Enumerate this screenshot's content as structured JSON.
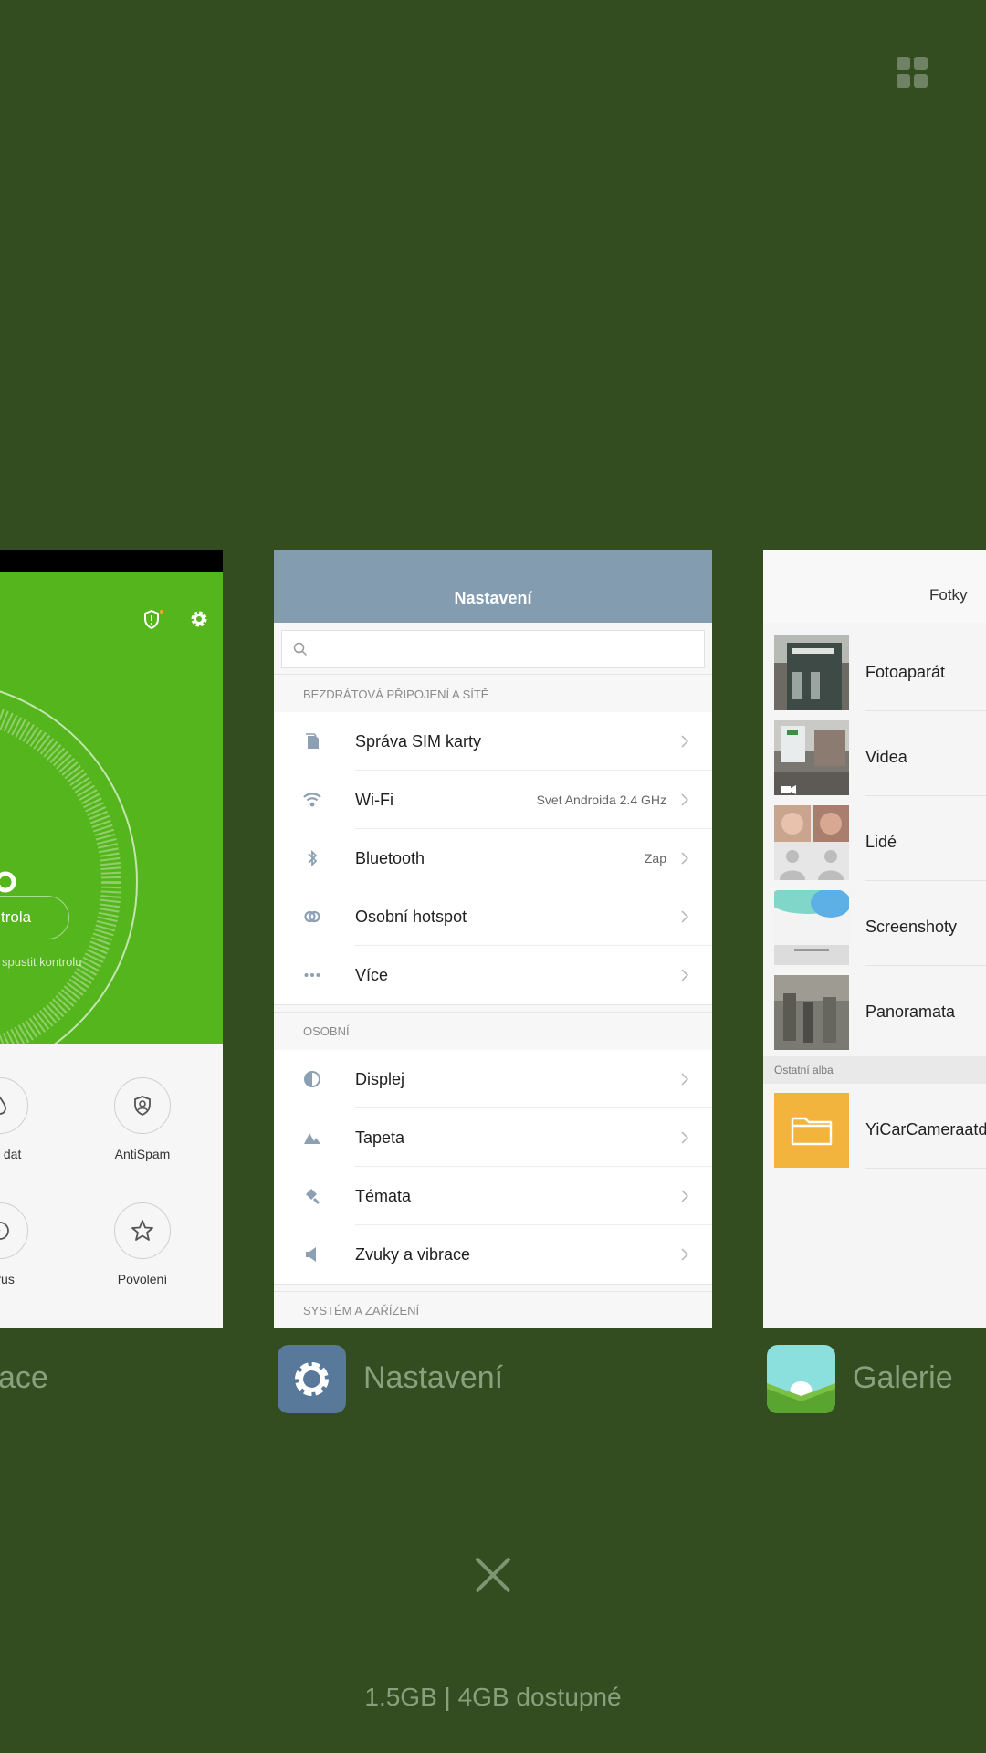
{
  "cards": {
    "security": {
      "app_label": "ace",
      "button_label": "trola",
      "hint": "spustit kontrolu",
      "tools": [
        {
          "label": "eba dat"
        },
        {
          "label": "AntiSpam"
        },
        {
          "label": "Virus"
        },
        {
          "label": "Povolení"
        }
      ]
    },
    "settings": {
      "title": "Nastavení",
      "app_label": "Nastavení",
      "search_placeholder": "",
      "sections": [
        {
          "label": "BEZDRÁTOVÁ PŘIPOJENÍ A SÍTĚ"
        },
        {
          "label": "OSOBNÍ"
        },
        {
          "label": "SYSTÉM A ZAŘÍZENÍ"
        }
      ],
      "rows": [
        {
          "label": "Správa SIM karty",
          "value": "",
          "icon": "sim-card-icon"
        },
        {
          "label": "Wi-Fi",
          "value": "Svet Androida 2.4 GHz",
          "icon": "wifi-icon"
        },
        {
          "label": "Bluetooth",
          "value": "Zap",
          "icon": "bluetooth-icon"
        },
        {
          "label": "Osobní hotspot",
          "value": "",
          "icon": "hotspot-icon"
        },
        {
          "label": "Více",
          "value": "",
          "icon": "more-icon"
        },
        {
          "label": "Displej",
          "value": "",
          "icon": "display-icon"
        },
        {
          "label": "Tapeta",
          "value": "",
          "icon": "wallpaper-icon"
        },
        {
          "label": "Témata",
          "value": "",
          "icon": "themes-icon"
        },
        {
          "label": "Zvuky a vibrace",
          "value": "",
          "icon": "sound-icon"
        }
      ]
    },
    "gallery": {
      "title": "Fotky",
      "app_label": "Galerie",
      "albums": [
        {
          "name": "Fotoaparát"
        },
        {
          "name": "Videa"
        },
        {
          "name": "Lidé"
        },
        {
          "name": "Screenshoty"
        },
        {
          "name": "Panoramata"
        }
      ],
      "other_label": "Ostatní alba",
      "other_albums": [
        {
          "name": "YiCarCameraatd"
        }
      ]
    }
  },
  "memory": "1.5GB | 4GB dostupné",
  "colors": {
    "background": "#334d20",
    "security_green": "#55b51c",
    "settings_header": "#849cb0",
    "label_text": "#8aa07c"
  }
}
